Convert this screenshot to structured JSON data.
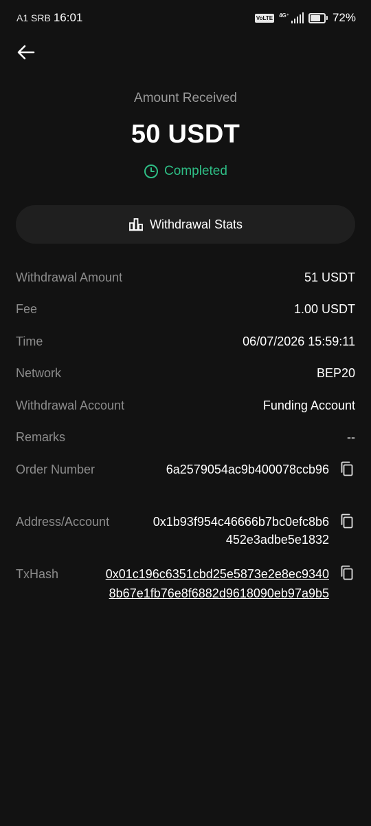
{
  "status_bar": {
    "carrier": "A1 SRB",
    "time": "16:01",
    "volte": "VoLTE",
    "network_type": "4G⁺",
    "battery_percent": "72%",
    "battery_level": 0.72
  },
  "header": {
    "amount_label": "Amount Received",
    "amount_value": "50 USDT",
    "status": "Completed",
    "status_color": "#2ebd85"
  },
  "stats_button": {
    "label": "Withdrawal Stats"
  },
  "details": {
    "withdrawal_amount": {
      "label": "Withdrawal Amount",
      "value": "51 USDT"
    },
    "fee": {
      "label": "Fee",
      "value": "1.00 USDT"
    },
    "time": {
      "label": "Time",
      "value": "06/07/2026 15:59:11"
    },
    "network": {
      "label": "Network",
      "value": "BEP20"
    },
    "withdrawal_account": {
      "label": "Withdrawal Account",
      "value": "Funding Account"
    },
    "remarks": {
      "label": "Remarks",
      "value": "--"
    },
    "order_number": {
      "label": "Order Number",
      "value": "6a2579054ac9b400078ccb96"
    },
    "address": {
      "label": "Address/Account",
      "value": "0x1b93f954c46666b7bc0efc8b6452e3adbe5e1832"
    },
    "txhash": {
      "label": "TxHash",
      "value": "0x01c196c6351cbd25e5873e2e8ec93408b67e1fb76e8f6882d9618090eb97a9b5"
    }
  },
  "icons": {
    "back": "arrow-left-icon",
    "status": "clock-icon",
    "stats": "bar-chart-icon",
    "copy": "copy-icon"
  },
  "colors": {
    "background": "#121212",
    "surface": "#1f1f1f",
    "success": "#2ebd85",
    "label": "#8c8c8c"
  }
}
